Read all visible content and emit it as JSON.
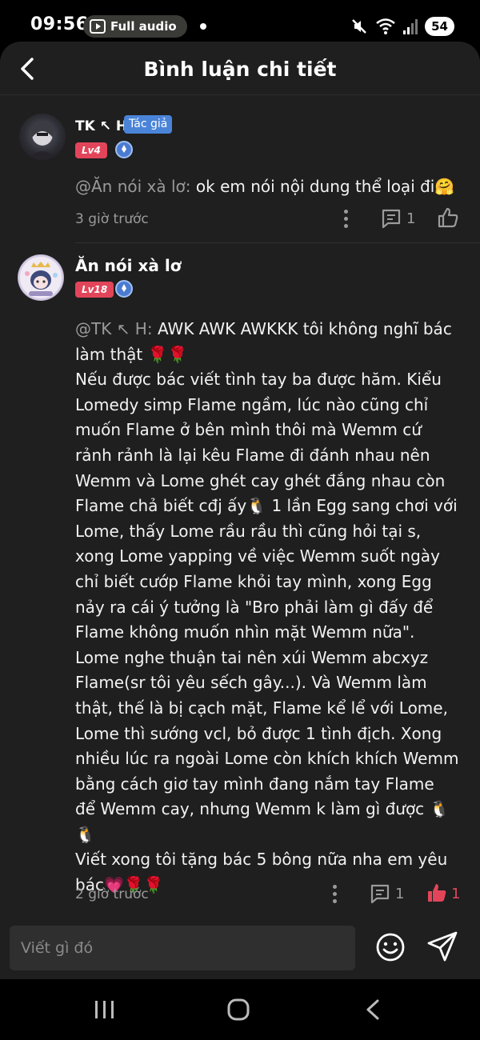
{
  "status_bar": {
    "time": "09:56",
    "media_pill": "Full audio",
    "battery": "54"
  },
  "header": {
    "title": "Bình luận chi tiết"
  },
  "comments": [
    {
      "username": "TK ↖ H",
      "author_tag": "Tác giả",
      "level": "Lv4",
      "mention": "@Ăn nói xà lơ:",
      "text": " ok em nói nội dung thể loại đi🤗",
      "timestamp": "3 giờ trước",
      "reply_count": "1",
      "like_count": ""
    },
    {
      "username": "Ăn nói xà lơ",
      "level": "Lv18",
      "mention": "@TK ↖ H:",
      "text": " AWK AWK AWKKK tôi không nghĩ bác làm thật 🌹🌹\nNếu được bác viết tình tay ba được hăm. Kiểu Lomedy simp Flame ngầm, lúc nào cũng chỉ muốn Flame ở bên mình thôi mà Wemm cứ rảnh rảnh là lại kêu Flame đi đánh nhau nên Wemm và Lome ghét cay ghét đắng nhau còn Flame chả biết cđj ấy🐧 1 lần Egg sang chơi với Lome, thấy Lome rầu rầu thì cũng hỏi tại s, xong Lome yapping về việc Wemm suốt ngày chỉ biết cướp Flame khỏi tay mình, xong Egg nảy ra cái ý tưởng là \"Bro phải làm gì đấy để Flame không muốn nhìn mặt Wemm nữa\". Lome nghe thuận tai nên xúi Wemm abcxyz Flame(sr tôi yêu sếch gây...). Và Wemm làm thật, thế là bị cạch mặt, Flame kể lể với Lome, Lome thì sướng vcl, bỏ được 1 tình địch. Xong nhiều lúc ra ngoài Lome còn khích khích Wemm bằng cách giơ tay mình đang nắm tay Flame để Wemm cay, nhưng Wemm k làm gì được 🐧🐧\nViết xong tôi tặng bác 5 bông nữa nha em yêu bác💗🌹🌹",
      "timestamp": "2 giờ trước",
      "reply_count": "1",
      "like_count": "1"
    }
  ],
  "input": {
    "placeholder": "Viết gì đó"
  },
  "colors": {
    "accent_red": "#e2455a",
    "author_tag_blue": "#4a84d8",
    "background": "#1f1f1f"
  }
}
